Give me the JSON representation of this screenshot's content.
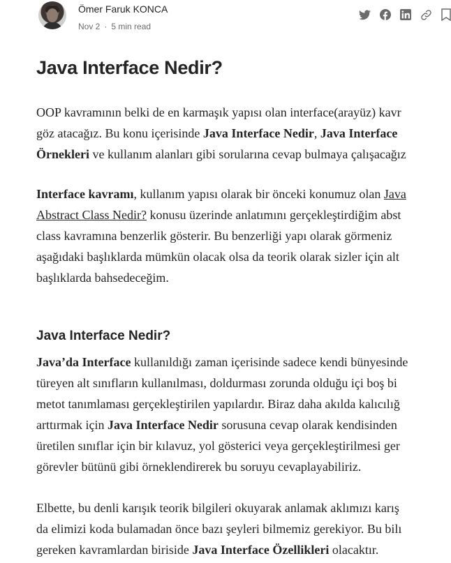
{
  "author": {
    "name": "Ömer Faruk KONCA",
    "date": "Nov 2",
    "read_time": "5 min read"
  },
  "share_icons": [
    "twitter-icon",
    "facebook-icon",
    "linkedin-icon",
    "link-icon",
    "bookmark-icon"
  ],
  "article": {
    "title": "Java Interface Nedir?",
    "p1": {
      "l1": "OOP kavramının belki de en karmaşık yapısı olan interface(arayüz) kavr",
      "l2a": "göz atacağız. Bu konu içerisinde ",
      "l2b": "Java Interface Nedir",
      "l2c": ", ",
      "l2d": "Java Interface",
      "l3a": "Örnekleri",
      "l3b": " ve kullanım alanları gibi sorularına cevap bulmaya çalışacağız"
    },
    "p2": {
      "l1a": "Interface kavramı",
      "l1b": ", kullanım yapısı olarak bir önceki konumuz olan ",
      "l1c": "Java",
      "l2a": "Abstract Class Nedir?",
      "l2b": " konusu üzerinde anlatımını gerçekleştirdiğim abst",
      "l3": "class kavramına benzerlik gösterir. Bu benzerliği yapı olarak görmeniz",
      "l4": "aşağıdaki başlıklarda mümkün olacak olsa da teorik olarak sizler için alt",
      "l5": "başlıklarda bahsedeceğim."
    },
    "h2": "Java Interface Nedir?",
    "p3": {
      "l1a": "Java’da Interface",
      "l1b": " kullanıldığı zaman içerisinde sadece kendi bünyesinde",
      "l2": "türeyen alt sınıfların kullanılması, doldurması zorunda olduğu içi boş bi",
      "l3": "metot tanımlaması gerçekleştirilen yapılardır. Biraz daha akılda kalıcılığ",
      "l4a": "arttırmak için ",
      "l4b": "Java Interface Nedir",
      "l4c": " sorusuna cevap olarak kendisinden",
      "l5": "üretilen sınıflar için bir kılavuz, yol gösterici veya gerçekleştirilmesi ger",
      "l6": "görevler bütünü gibi örneklendirerek bu soruyu cevaplayabiliriz."
    },
    "p4": {
      "l1": "Elbette, bu denli karışık teorik bilgileri okuyarak anlamak aklımızı karış",
      "l2": "da elimizi koda bulamadan önce bazı şeyleri bilmemiz gerekiyor. Bu bilı",
      "l3a": "gereken kavramlardan biriside ",
      "l3b": "Java Interface Özellikleri",
      "l3c": " olacaktır."
    }
  }
}
